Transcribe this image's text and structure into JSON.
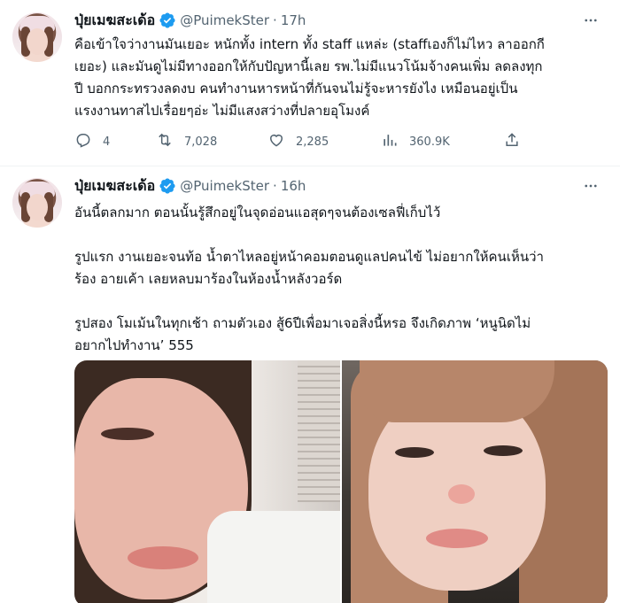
{
  "tweets": [
    {
      "author_name": "ปุ่ยเมฆสะเด้อ",
      "handle": "@PuimekSter",
      "separator": "·",
      "time": "17h",
      "text_lines": [
        "คือเข้าใจว่างานมันเยอะ หนักทั้ง intern ทั้ง staff แหล่ะ (staffเองก็ไม่ไหว ลาออกกี",
        "เยอะ) และมันดูไม่มีทางออกให้กับปัญหานี้เลย รพ.ไม่มีแนวโน้มจ้างคนเพิ่ม ลดลงทุก",
        "ปี บอกกระทรวงลดงบ คนทำงานหารหน้าที่กันจนไม่รู้จะหารยังไง เหมือนอยู่เป็น",
        "แรงงานทาสไปเรื่อยๆอ่ะ ไม่มีแสงสว่างที่ปลายอุโมงค์"
      ],
      "actions": {
        "replies": "4",
        "retweets": "7,028",
        "likes": "2,285",
        "views": "360.9K"
      }
    },
    {
      "author_name": "ปุ่ยเมฆสะเด้อ",
      "handle": "@PuimekSter",
      "separator": "·",
      "time": "16h",
      "paragraphs": [
        [
          "อันนี้ตลกมาก ตอนนั้นรู้สึกอยู่ในจุดอ่อนแอสุดๆจนต้องเซลฟี่เก็บไว้"
        ],
        [
          "รูปแรก งานเยอะจนท้อ น้ำตาไหลอยู่หน้าคอมตอนดูแลปคนไข้ ไม่อยากให้คนเห็นว่า",
          "ร้อง อายเค้า เลยหลบมาร้องในห้องน้ำหลังวอร์ด"
        ],
        [
          "รูปสอง โมเม้นในทุกเช้า ถามตัวเอง สู้6ปีเพื่อมาเจอสิ่งนี้หรอ จึงเกิดภาพ ‘หนูนิดไม่",
          "อยากไปทำงาน’ 555"
        ]
      ]
    }
  ],
  "colors": {
    "verified_blue": "#1d9bf0",
    "text_secondary": "#536471",
    "text_primary": "#0f1419",
    "divider": "#eff3f4"
  },
  "icons": [
    "verified-badge-icon",
    "more-icon",
    "reply-icon",
    "retweet-icon",
    "like-icon",
    "views-icon",
    "share-icon"
  ]
}
